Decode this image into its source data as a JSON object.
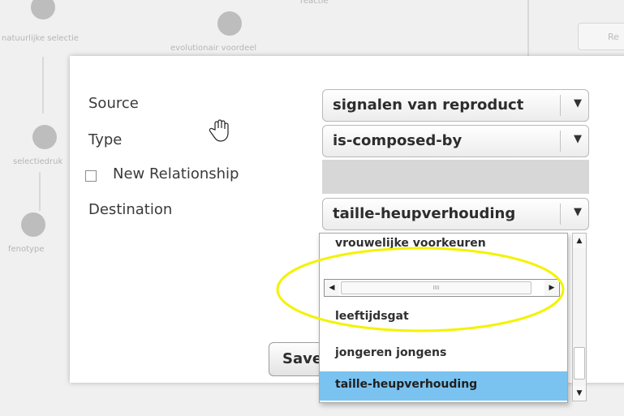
{
  "background": {
    "nodes": [
      {
        "label": "natuurlijke selectie"
      },
      {
        "label": "evolutionair voordeel"
      },
      {
        "label": "selectiedruk"
      },
      {
        "label": "fenotype"
      }
    ],
    "top_label": "reactie",
    "right_button_label": "Re"
  },
  "dialog": {
    "labels": {
      "source": "Source",
      "type": "Type",
      "new_relationship": "New Relationship",
      "destination": "Destination"
    },
    "source_value": "signalen van reproduct",
    "type_value": "is-composed-by",
    "destination_value": "taille-heupverhouding",
    "new_relationship_checked": false,
    "save_label": "Save",
    "dropdown_options": [
      "vrouwelijke voorkeuren",
      "leeftijdsgat",
      "jongeren jongens",
      "taille-heupverhouding"
    ],
    "selected_option": "taille-heupverhouding",
    "hscroll_grip": "IIII"
  },
  "colors": {
    "selected_row": "#7ac2f0",
    "highlight_ellipse": "#f3f300",
    "disabled_field": "#d7d7d7"
  },
  "icons": [
    "hand-cursor-icon",
    "dropdown-arrow-icon",
    "scroll-up-icon",
    "scroll-down-icon",
    "scroll-left-icon",
    "scroll-right-icon"
  ]
}
